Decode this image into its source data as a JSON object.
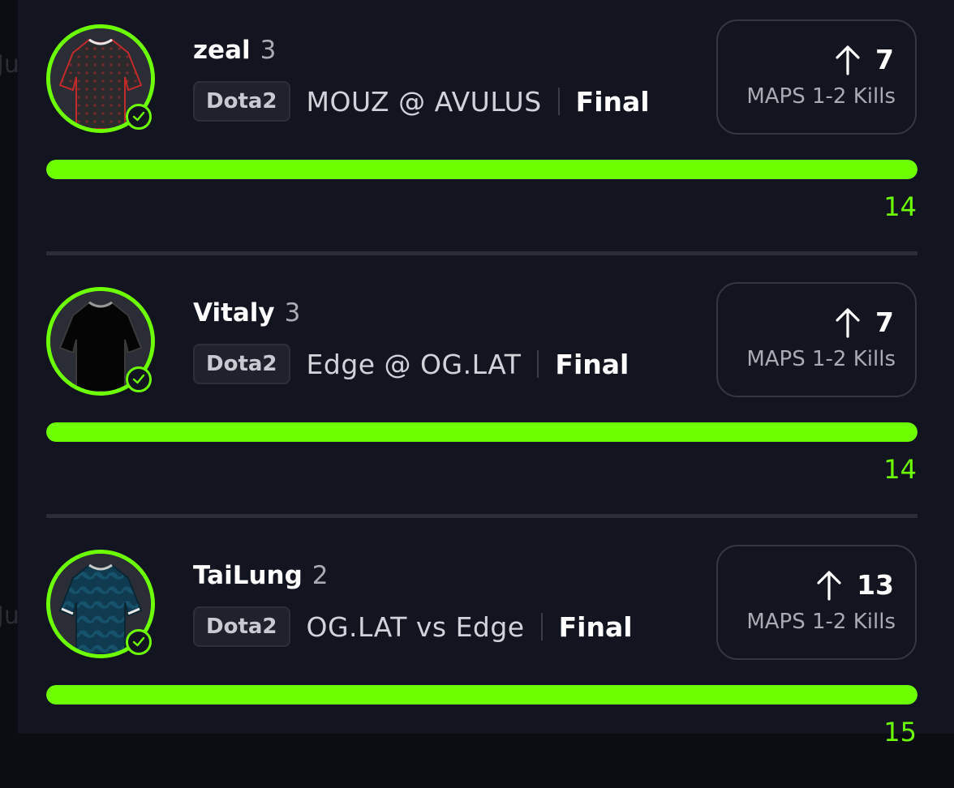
{
  "background": {
    "peek_text": [
      "Ju",
      "Ju"
    ]
  },
  "colors": {
    "accent": "#6dff00",
    "panel": "#12141f",
    "text_muted": "#a9abb3"
  },
  "entries": [
    {
      "player": "zeal",
      "count": "3",
      "game": "Dota2",
      "matchup": "MOUZ @ AVULUS",
      "status": "Final",
      "direction_icon": "arrow-up-icon",
      "stat_value": "7",
      "stat_label": "MAPS 1-2 Kills",
      "progress_value": "14",
      "progress_fraction": 1.0,
      "jersey": "red-black-patterned"
    },
    {
      "player": "Vitaly",
      "count": "3",
      "game": "Dota2",
      "matchup": "Edge @ OG.LAT",
      "status": "Final",
      "direction_icon": "arrow-up-icon",
      "stat_value": "7",
      "stat_label": "MAPS 1-2 Kills",
      "progress_value": "14",
      "progress_fraction": 1.0,
      "jersey": "black"
    },
    {
      "player": "TaiLung",
      "count": "2",
      "game": "Dota2",
      "matchup": "OG.LAT vs Edge",
      "status": "Final",
      "direction_icon": "arrow-up-icon",
      "stat_value": "13",
      "stat_label": "MAPS 1-2 Kills",
      "progress_value": "15",
      "progress_fraction": 1.0,
      "jersey": "blue-patterned"
    }
  ]
}
